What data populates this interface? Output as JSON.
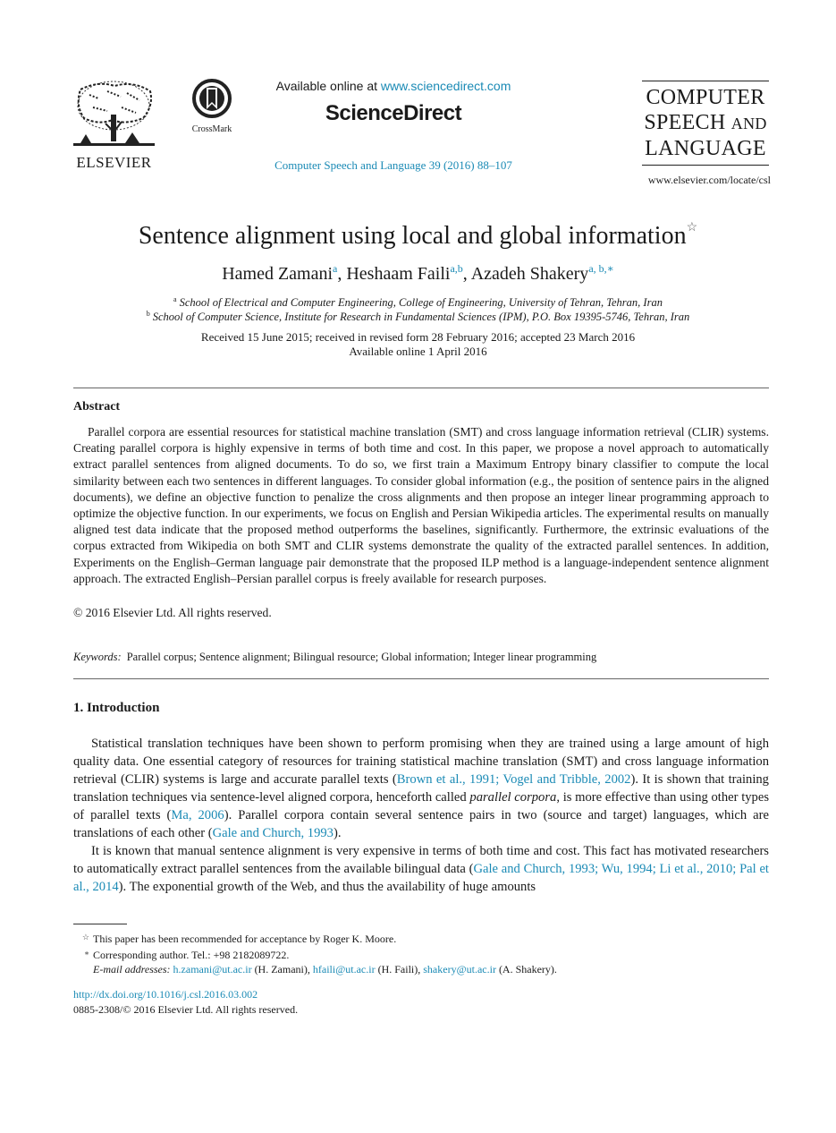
{
  "header": {
    "publisher_logo": "elsevier-tree-logo",
    "publisher_name": "ELSEVIER",
    "crossmark_icon": "crossmark-icon",
    "crossmark_label": "CrossMark",
    "available_online_prefix": "Available online at ",
    "available_online_link": "www.sciencedirect.com",
    "sciencedirect": "ScienceDirect",
    "journal_reference": "Computer Speech and Language 39 (2016) 88–107",
    "journal_title_line1": "COMPUTER",
    "journal_title_line2_main": "SPEECH",
    "journal_title_line2_small": "AND",
    "journal_title_line3": "LANGUAGE",
    "journal_url": "www.elsevier.com/locate/csl",
    "accent_color": "#1a8ab5"
  },
  "article": {
    "title": "Sentence alignment using local and global information",
    "title_note_mark": "☆",
    "authors": [
      {
        "name": "Hamed Zamani",
        "affil": "a"
      },
      {
        "name": "Heshaam Faili",
        "affil": "a,b"
      },
      {
        "name": "Azadeh Shakery",
        "affil": "a, b,∗"
      }
    ],
    "affiliations": [
      {
        "mark": "a",
        "text": "School of Electrical and Computer Engineering, College of Engineering, University of Tehran, Tehran, Iran"
      },
      {
        "mark": "b",
        "text": "School of Computer Science, Institute for Research in Fundamental Sciences (IPM), P.O. Box 19395-5746, Tehran, Iran"
      }
    ],
    "received": "Received 15 June 2015; received in revised form 28 February 2016; accepted 23 March 2016",
    "available_online": "Available online 1 April 2016"
  },
  "abstract": {
    "heading": "Abstract",
    "text": "Parallel corpora are essential resources for statistical machine translation (SMT) and cross language information retrieval (CLIR) systems. Creating parallel corpora is highly expensive in terms of both time and cost. In this paper, we propose a novel approach to automatically extract parallel sentences from aligned documents. To do so, we first train a Maximum Entropy binary classifier to compute the local similarity between each two sentences in different languages. To consider global information (e.g., the position of sentence pairs in the aligned documents), we define an objective function to penalize the cross alignments and then propose an integer linear programming approach to optimize the objective function. In our experiments, we focus on English and Persian Wikipedia articles. The experimental results on manually aligned test data indicate that the proposed method outperforms the baselines, significantly. Furthermore, the extrinsic evaluations of the corpus extracted from Wikipedia on both SMT and CLIR systems demonstrate the quality of the extracted parallel sentences. In addition, Experiments on the English–German language pair demonstrate that the proposed ILP method is a language-independent sentence alignment approach. The extracted English–Persian parallel corpus is freely available for research purposes.",
    "copyright": "© 2016 Elsevier Ltd. All rights reserved."
  },
  "keywords": {
    "label": "Keywords:",
    "text": "Parallel corpus; Sentence alignment; Bilingual resource; Global information; Integer linear programming"
  },
  "introduction": {
    "heading": "1.  Introduction",
    "p1": [
      {
        "t": "Statistical translation techniques have been shown to perform promising when they are trained using a large amount of high quality data. One essential category of resources for training statistical machine translation (SMT) and cross language information retrieval (CLIR) systems is large and accurate parallel texts ("
      },
      {
        "t": "Brown et al., 1991; Vogel and Tribble, 2002",
        "link": true
      },
      {
        "t": "). It is shown that training translation techniques via sentence-level aligned corpora, henceforth called "
      },
      {
        "t": "parallel corpora",
        "italic": true
      },
      {
        "t": ", is more effective than using other types of parallel texts ("
      },
      {
        "t": "Ma, 2006",
        "link": true
      },
      {
        "t": "). Parallel corpora contain several sentence pairs in two (source and target) languages, which are translations of each other ("
      },
      {
        "t": "Gale and Church, 1993",
        "link": true
      },
      {
        "t": ")."
      }
    ],
    "p2": [
      {
        "t": "It is known that manual sentence alignment is very expensive in terms of both time and cost. This fact has motivated researchers to automatically extract parallel sentences from the available bilingual data ("
      },
      {
        "t": "Gale and Church, 1993; Wu, 1994; Li et al., 2010; Pal et al., 2014",
        "link": true
      },
      {
        "t": "). The exponential growth of the Web, and thus the availability of huge amounts"
      }
    ]
  },
  "footnotes": {
    "star_mark": "☆",
    "star_text": "This paper has been recommended for acceptance by Roger K. Moore.",
    "corresponding_mark": "∗",
    "corresponding_text": "Corresponding author. Tel.: +98 2182089722.",
    "email_label": "E-mail addresses:",
    "emails": [
      {
        "email": "h.zamani@ut.ac.ir",
        "name": " (H. Zamani), "
      },
      {
        "email": "hfaili@ut.ac.ir",
        "name": " (H. Faili), "
      },
      {
        "email": "shakery@ut.ac.ir",
        "name": " (A. Shakery)."
      }
    ],
    "doi": "http://dx.doi.org/10.1016/j.csl.2016.03.002",
    "issn": "0885-2308/© 2016 Elsevier Ltd. All rights reserved."
  }
}
